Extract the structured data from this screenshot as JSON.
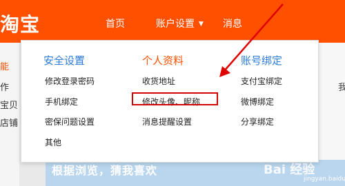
{
  "header": {
    "logo_text": "淘宝",
    "nav": {
      "home": "首页",
      "account_settings": "账户设置",
      "messages": "消息"
    }
  },
  "left_sidebar": {
    "items": [
      "能",
      "作",
      "宝贝",
      "店铺"
    ]
  },
  "right_fragment_text": "我",
  "dropdown": {
    "columns": [
      {
        "header": "安全设置",
        "items": [
          "修改登录密码",
          "手机绑定",
          "密保问题设置",
          "其他"
        ]
      },
      {
        "header": "个人资料",
        "items": [
          "收货地址",
          "修改头像、昵称",
          "消息提醒设置"
        ]
      },
      {
        "header": "账号绑定",
        "items": [
          "支付宝绑定",
          "微博绑定",
          "分享绑定"
        ]
      }
    ]
  },
  "background_banner_text": "根据浏览，猜我喜欢",
  "watermark": {
    "brand": "Bai 经验",
    "url": "jingyan.baidu.com"
  },
  "colors": {
    "brand_orange": "#ff5000",
    "header_blue": "#2b7bd9",
    "highlight_red": "#d40000"
  }
}
